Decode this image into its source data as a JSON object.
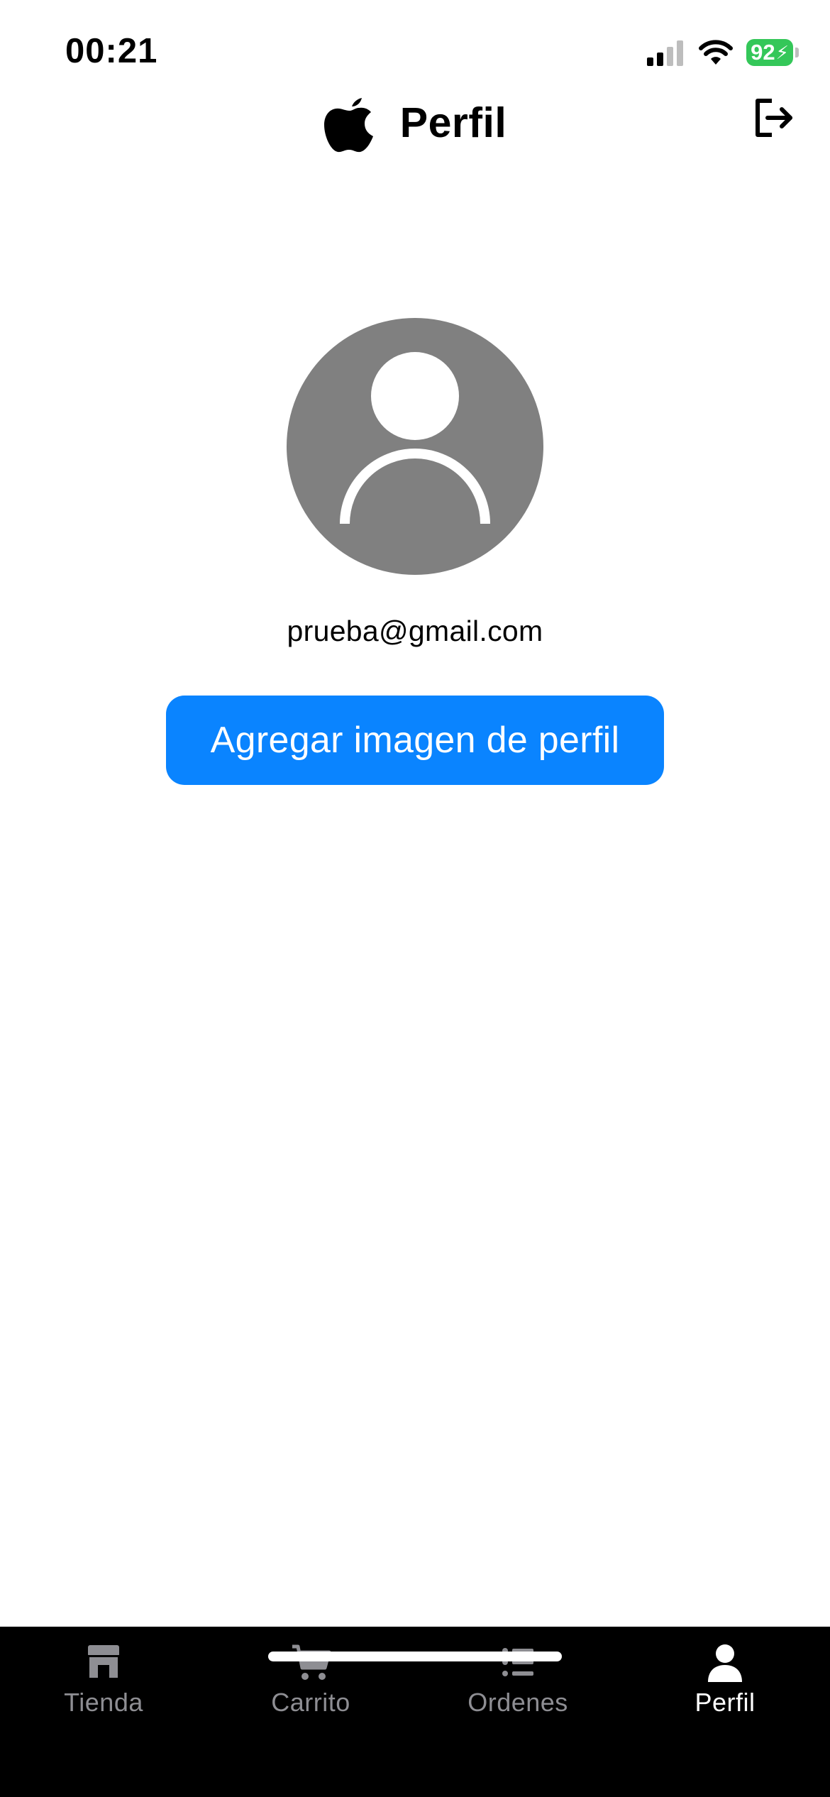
{
  "status_bar": {
    "time": "00:21",
    "battery_level": "92",
    "icons": [
      "signal-icon",
      "wifi-icon",
      "battery-charging-icon"
    ]
  },
  "header": {
    "logo_icon": "apple-logo-icon",
    "title": "Perfil",
    "logout_icon": "logout-icon"
  },
  "profile": {
    "avatar_icon": "person-placeholder-icon",
    "email": "prueba@gmail.com",
    "add_photo_label": "Agregar imagen de perfil"
  },
  "tabs": [
    {
      "label": "Tienda",
      "icon": "store-icon",
      "active": false
    },
    {
      "label": "Carrito",
      "icon": "cart-icon",
      "active": false
    },
    {
      "label": "Ordenes",
      "icon": "list-icon",
      "active": false
    },
    {
      "label": "Perfil",
      "icon": "person-icon",
      "active": true
    }
  ],
  "colors": {
    "accent": "#0a84ff",
    "battery": "#34c759",
    "avatar_bg": "#808080",
    "tab_bar_bg": "#000000",
    "tab_inactive": "#8e8e93",
    "tab_active": "#ffffff"
  }
}
